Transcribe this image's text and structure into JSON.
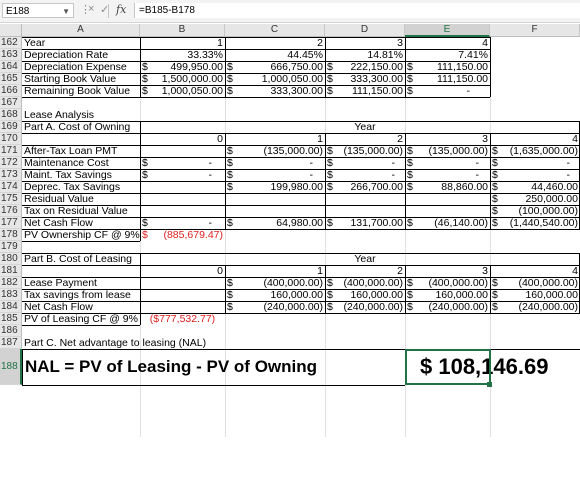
{
  "formula_bar": {
    "name_box": "E188",
    "formula": "=B185-B178",
    "cancel_icon": "×",
    "enter_icon": "✓",
    "fx_label": "fx"
  },
  "columns": [
    "A",
    "B",
    "C",
    "D",
    "E",
    "F"
  ],
  "selected_column": "E",
  "selected_row": "188",
  "rows": [
    {
      "n": "162",
      "cells": [
        "Year",
        "1",
        "2",
        "3",
        "4",
        ""
      ]
    },
    {
      "n": "163",
      "cells": [
        "Depreciation Rate",
        "33.33%",
        "44.45%",
        "14.81%",
        "7.41%",
        ""
      ]
    },
    {
      "n": "164",
      "cells": [
        "Depreciation Expense",
        "$   499,950.00",
        "$",
        "666,750.00",
        "$  222,150.00",
        "$   111,150.00"
      ]
    },
    {
      "n": "165",
      "cells": [
        "Starting Book Value",
        "$ 1,500,000.00",
        "$",
        "1,000,050.00",
        "$  333,300.00",
        "$   111,150.00"
      ]
    },
    {
      "n": "166",
      "cells": [
        "Remaining Book Value",
        "$ 1,000,050.00",
        "$",
        "333,300.00",
        "$  111,150.00",
        "$"
      ]
    },
    {
      "n": "167",
      "cells": [
        "",
        "",
        "",
        "",
        "",
        ""
      ]
    },
    {
      "n": "168",
      "cells": [
        "Lease Analysis",
        "",
        "",
        "",
        "",
        ""
      ]
    },
    {
      "n": "169",
      "cells": [
        "Part A. Cost of Owning",
        "",
        "",
        "Year",
        "",
        ""
      ]
    },
    {
      "n": "170",
      "cells": [
        "",
        "0",
        "1",
        "2",
        "3",
        "4"
      ]
    },
    {
      "n": "171",
      "cells": [
        "After-Tax Loan PMT",
        "",
        "$",
        "(135,000.00)",
        "$  (135,000.00)",
        "$   (135,000.00)",
        "$  (1,635,000.00)"
      ]
    },
    {
      "n": "172",
      "cells": [
        "Maintenance Cost",
        "$",
        "-",
        "$",
        "-",
        "$",
        "-"
      ]
    },
    {
      "n": "173",
      "cells": [
        "Maint. Tax Savings",
        "$",
        "-",
        "$",
        "-",
        "$",
        "-"
      ]
    },
    {
      "n": "174",
      "cells": [
        "Deprec. Tax Savings",
        "",
        "$",
        "199,980.00",
        "$  266,700.00",
        "$",
        "88,860.00"
      ]
    },
    {
      "n": "175",
      "cells": [
        "Residual Value",
        "",
        "",
        "",
        "",
        "",
        ""
      ]
    },
    {
      "n": "176",
      "cells": [
        "Tax on Residual Value",
        "",
        "",
        "",
        "",
        "",
        ""
      ]
    },
    {
      "n": "177",
      "cells": [
        "Net Cash Flow",
        "$",
        "-",
        "$",
        "64,980.00",
        "$  131,700.00",
        "$"
      ]
    },
    {
      "n": "178",
      "cells": [
        "PV Ownership CF @ 9%",
        "$   (885,679.47)",
        "",
        "",
        "",
        "",
        ""
      ]
    },
    {
      "n": "179",
      "cells": [
        "",
        "",
        "",
        "",
        "",
        "",
        ""
      ]
    },
    {
      "n": "180",
      "cells": [
        "Part B. Cost of Leasing",
        "",
        "",
        "Year",
        "",
        "",
        ""
      ]
    },
    {
      "n": "181",
      "cells": [
        "",
        "0",
        "1",
        "2",
        "3",
        "4",
        ""
      ]
    },
    {
      "n": "182",
      "cells": [
        "Lease Payment",
        "",
        "$",
        "(400,000.00)",
        "$  (400,000.00)",
        "$",
        "(400,000.00)"
      ]
    },
    {
      "n": "183",
      "cells": [
        "Tax savings from lease",
        "",
        "$",
        "160,000.00",
        "$  160,000.00",
        "$",
        "160,000.00"
      ]
    },
    {
      "n": "184",
      "cells": [
        "Net Cash Flow",
        "",
        "$",
        "(240,000.00)",
        "$  (240,000.00)",
        "$",
        "(240,000.00)"
      ]
    },
    {
      "n": "185",
      "cells": [
        "PV of Leasing CF @ 9%",
        "($777,532.77)",
        "",
        "",
        "",
        "",
        ""
      ]
    },
    {
      "n": "186",
      "cells": [
        "",
        "",
        "",
        "",
        "",
        "",
        ""
      ]
    },
    {
      "n": "187",
      "cells": [
        "Part C. Net advantage to leasing (NAL)",
        "",
        "",
        "",
        "",
        "",
        ""
      ]
    },
    {
      "n": "188",
      "cells": [
        "NAL = PV of Leasing - PV of Owning",
        "",
        "",
        "",
        "$ 108,146.69",
        ""
      ]
    }
  ],
  "text": {
    "r164_e2": "$",
    "r164_f": "111,150.00",
    "r165_f": "111,150.00",
    "r166_f": "-",
    "r171_b": "",
    "r171_e_d": "$",
    "r171_e_v": "(46,140.00)",
    "r171_f_d": "$",
    "r171_f_v": "(1,635,000.00)",
    "r172_f_d": "$",
    "r172_f_v": "-",
    "r173_f_d": "$",
    "r173_f_v": "-",
    "r174_f_d": "$",
    "r174_f_v": "44,460.00",
    "r175_f_d": "$",
    "r175_f_v": "250,000.00",
    "r176_f_d": "$",
    "r176_f_v": "(100,000.00)",
    "r177_e_d": "$",
    "r177_e_v": "(46,140.00)",
    "r177_f_d": "$",
    "r177_f_v": "(1,440,540.00)",
    "r182_f_d": "$",
    "r182_f_v": "(400,000.00)",
    "r183_f_d": "$",
    "r183_f_v": "160,000.00",
    "r184_f_d": "$",
    "r184_f_v": "(240,000.00)"
  },
  "vals": {
    "r162": [
      "Year",
      "1",
      "2",
      "3",
      "4"
    ],
    "r163": [
      "Depreciation Rate",
      "33.33%",
      "44.45%",
      "14.81%",
      "7.41%"
    ],
    "r164": [
      "Depreciation Expense",
      "$",
      "499,950.00",
      "$",
      "666,750.00",
      "$",
      "222,150.00",
      "$",
      "111,150.00"
    ],
    "r165": [
      "Starting Book Value",
      "$",
      "1,500,000.00",
      "$",
      "1,000,050.00",
      "$",
      "333,300.00",
      "$",
      "111,150.00"
    ],
    "r166": [
      "Remaining Book Value",
      "$",
      "1,000,050.00",
      "$",
      "333,300.00",
      "$",
      "111,150.00",
      "$",
      "-"
    ],
    "r168": [
      "Lease Analysis"
    ],
    "r169": [
      "Part A. Cost of Owning",
      "Year"
    ],
    "r170": [
      "0",
      "1",
      "2",
      "3",
      "4"
    ],
    "r171": [
      "After-Tax Loan PMT",
      "$",
      "(135,000.00)",
      "$",
      "(135,000.00)",
      "$",
      "(135,000.00)",
      "$",
      "(1,635,000.00)"
    ],
    "r172": [
      "Maintenance Cost",
      "$",
      "-",
      "$",
      "-",
      "$",
      "-",
      "$",
      "-",
      "$",
      "-"
    ],
    "r173": [
      "Maint. Tax Savings",
      "$",
      "-",
      "$",
      "-",
      "$",
      "-",
      "$",
      "-",
      "$",
      "-"
    ],
    "r174": [
      "Deprec. Tax Savings",
      "$",
      "199,980.00",
      "$",
      "266,700.00",
      "$",
      "88,860.00",
      "$",
      "44,460.00"
    ],
    "r175": [
      "Residual Value",
      "$",
      "250,000.00"
    ],
    "r176": [
      "Tax on Residual Value",
      "$",
      "(100,000.00)"
    ],
    "r177": [
      "Net Cash Flow",
      "$",
      "-",
      "$",
      "-",
      "$",
      "64,980.00",
      "$",
      "131,700.00",
      "$",
      "(46,140.00)",
      "$",
      "(1,440,540.00)"
    ],
    "r178": [
      "PV Ownership CF @ 9%",
      "$",
      "(885,679.47)"
    ],
    "r180": [
      "Part B. Cost of Leasing",
      "Year"
    ],
    "r181": [
      "0",
      "1",
      "2",
      "3",
      "4"
    ],
    "r182": [
      "Lease Payment",
      "$",
      "(400,000.00)",
      "$",
      "(400,000.00)",
      "$",
      "(400,000.00)",
      "$",
      "(400,000.00)"
    ],
    "r183": [
      "Tax savings from lease",
      "$",
      "160,000.00",
      "$",
      "160,000.00",
      "$",
      "160,000.00",
      "$",
      "160,000.00"
    ],
    "r184": [
      "Net Cash Flow",
      "$",
      "(240,000.00)",
      "$",
      "(240,000.00)",
      "$",
      "(240,000.00)",
      "$",
      "(240,000.00)"
    ],
    "r185": [
      "PV of Leasing CF @ 9%",
      "($777,532.77)"
    ],
    "r187": [
      "Part C. Net advantage to leasing (NAL)"
    ],
    "r188": [
      "NAL = PV of Leasing - PV of Owning",
      "$ 108,146.69"
    ]
  },
  "colors": {
    "negative": "#e0201f",
    "selected": "#217346"
  }
}
